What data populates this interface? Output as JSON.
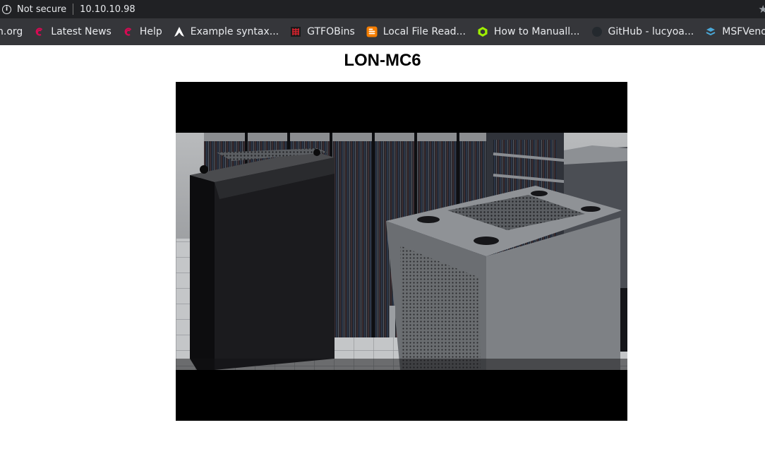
{
  "browser": {
    "security_label": "Not secure",
    "url": "10.10.10.98"
  },
  "bookmarks": [
    {
      "label": "n.org",
      "icon": "none"
    },
    {
      "label": "Latest News",
      "icon": "debian-swirl-icon"
    },
    {
      "label": "Help",
      "icon": "debian-swirl-icon"
    },
    {
      "label": "Example syntax...",
      "icon": "arch-linux-icon"
    },
    {
      "label": "GTFOBins",
      "icon": "gtfobins-icon"
    },
    {
      "label": "Local File Read...",
      "icon": "blogger-icon"
    },
    {
      "label": "How to Manuall...",
      "icon": "hackthebox-icon"
    },
    {
      "label": "GitHub - lucyoa...",
      "icon": "github-icon"
    },
    {
      "label": "MSFVenom",
      "icon": "msf-icon"
    }
  ],
  "page": {
    "title": "LON-MC6",
    "camera_feed": "server room camera image"
  }
}
